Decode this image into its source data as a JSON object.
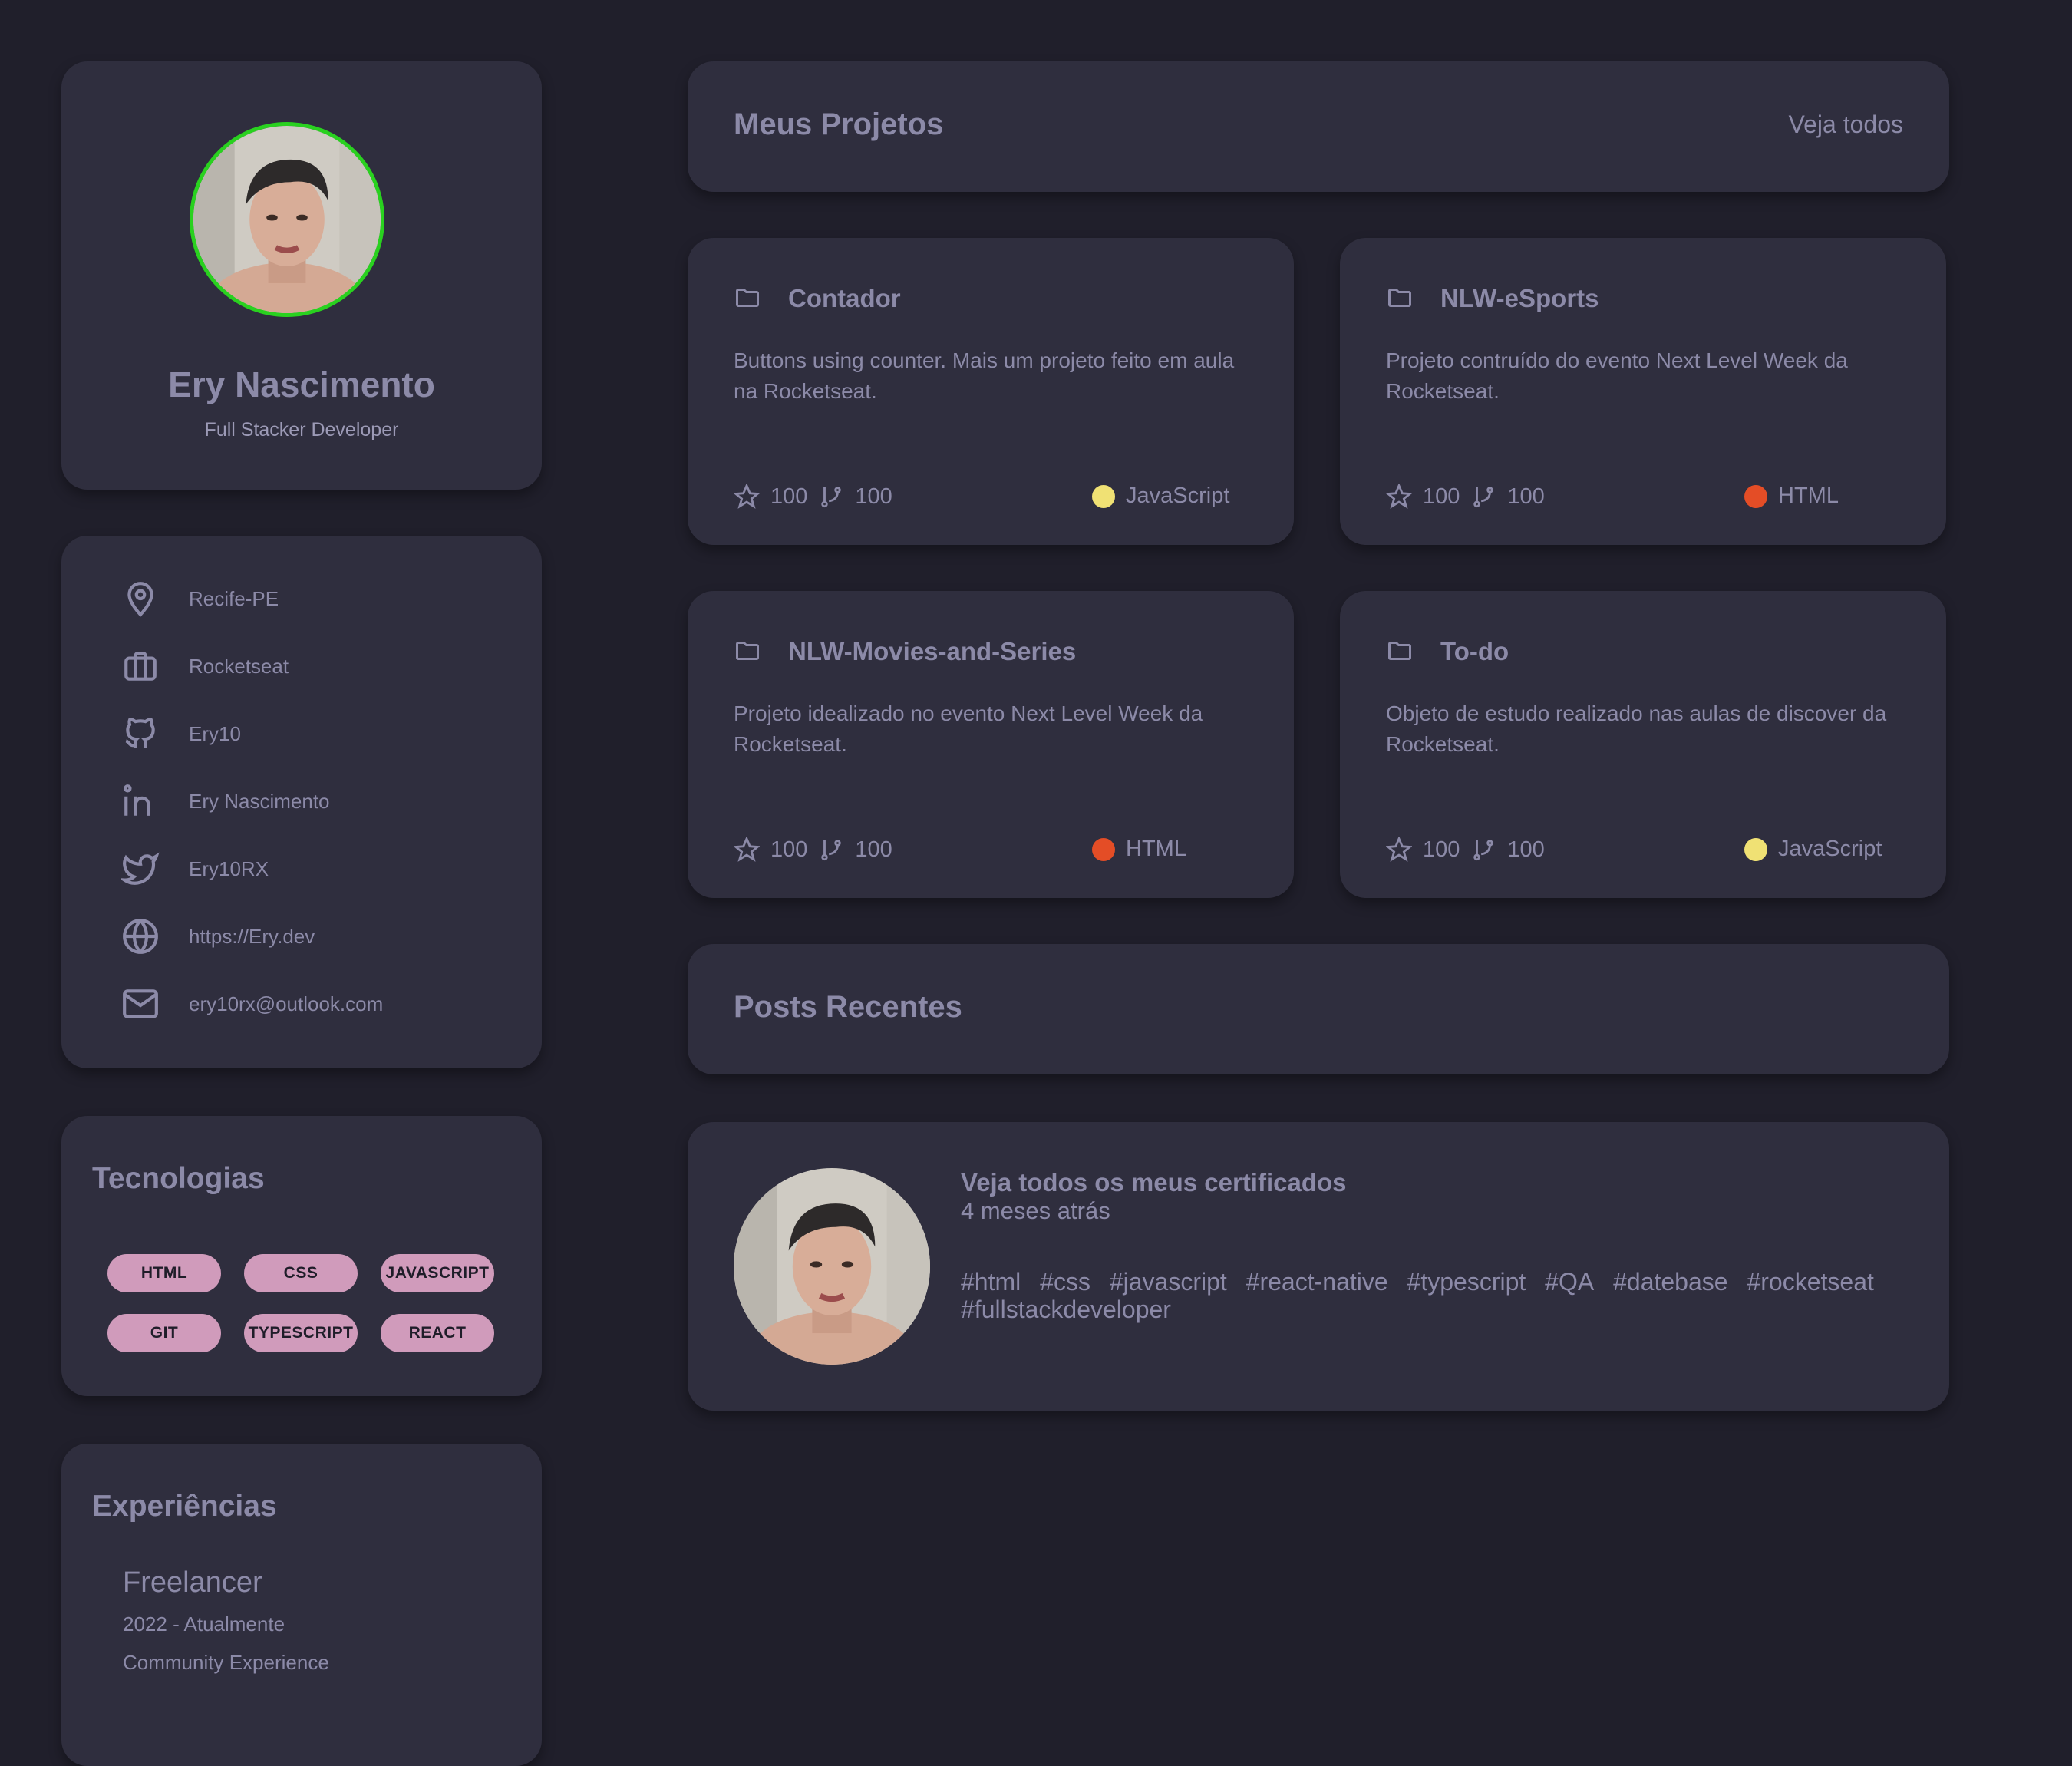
{
  "profile": {
    "name": "Ery Nascimento",
    "role": "Full Stacker Developer",
    "avatar_ring_color": "#29d11f"
  },
  "contacts": [
    {
      "icon": "map-pin-icon",
      "label": "Recife-PE"
    },
    {
      "icon": "briefcase-icon",
      "label": "Rocketseat"
    },
    {
      "icon": "github-icon",
      "label": "Ery10"
    },
    {
      "icon": "linkedin-icon",
      "label": "Ery Nascimento"
    },
    {
      "icon": "twitter-icon",
      "label": "Ery10RX"
    },
    {
      "icon": "globe-icon",
      "label": "https://Ery.dev"
    },
    {
      "icon": "mail-icon",
      "label": "ery10rx@outlook.com"
    }
  ],
  "technologies": {
    "title": "Tecnologias",
    "tags": [
      "HTML",
      "CSS",
      "JAVASCRIPT",
      "GIT",
      "TYPESCRIPT",
      "REACT"
    ]
  },
  "experience": {
    "title": "Experiências",
    "role": "Freelancer",
    "period": "2022 - Atualmente",
    "company": "Community Experience"
  },
  "projects": {
    "title": "Meus Projetos",
    "see_all": "Veja todos",
    "items": [
      {
        "name": "Contador",
        "description": "Buttons using counter. Mais um projeto feito em aula na Rocketseat.",
        "stars": "100",
        "forks": "100",
        "language": "JavaScript",
        "language_color": "#f0e174"
      },
      {
        "name": "NLW-eSports",
        "description": "Projeto contruído do evento Next Level Week da Rocketseat.",
        "stars": "100",
        "forks": "100",
        "language": "HTML",
        "language_color": "#e44d26"
      },
      {
        "name": "NLW-Movies-and-Series",
        "description": "Projeto idealizado no evento Next Level Week da Rocketseat.",
        "stars": "100",
        "forks": "100",
        "language": "HTML",
        "language_color": "#e44d26"
      },
      {
        "name": "To-do",
        "description": "Objeto de estudo realizado nas aulas de discover da Rocketseat.",
        "stars": "100",
        "forks": "100",
        "language": "JavaScript",
        "language_color": "#f0e174"
      }
    ]
  },
  "posts": {
    "title": "Posts Recentes",
    "items": [
      {
        "title": "Veja todos os meus certificados",
        "time": "4 meses atrás",
        "tags": [
          "#html",
          "#css",
          "#javascript",
          "#react-native",
          "#typescript",
          "#QA",
          "#datebase",
          "#rocketseat",
          "#fullstackdeveloper"
        ]
      }
    ]
  },
  "colors": {
    "background": "#201f2b",
    "card": "#2f2e3e",
    "text": "#8c8aa8",
    "tag_bg": "#d09bbb"
  }
}
